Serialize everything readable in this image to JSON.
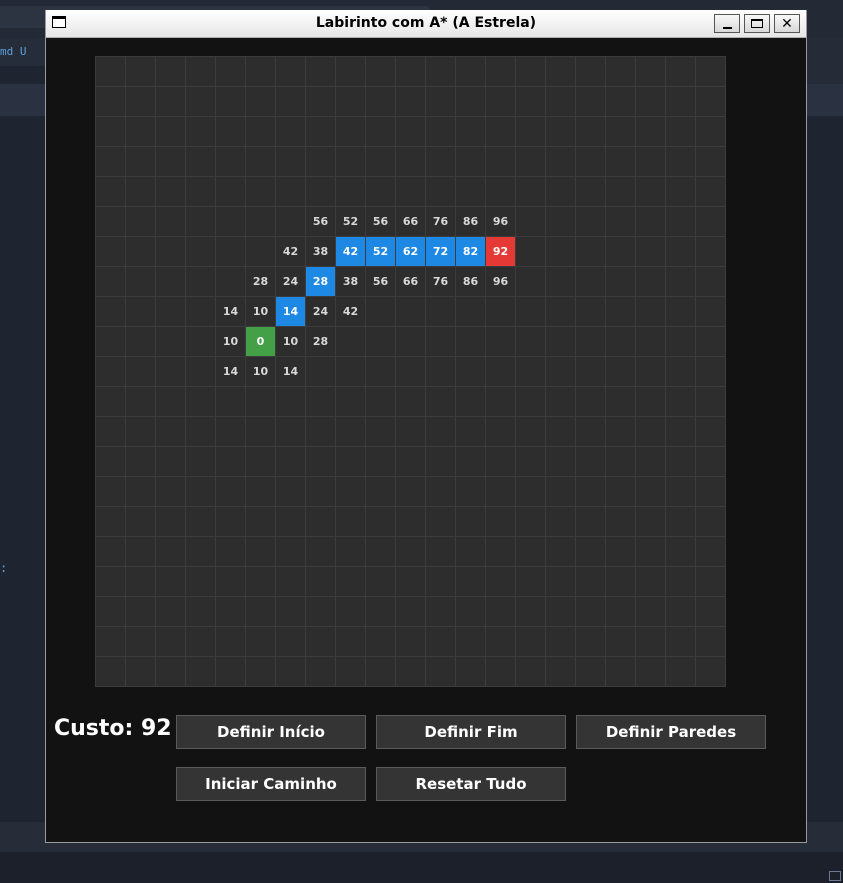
{
  "window": {
    "title": "Labirinto com A* (A Estrela)"
  },
  "background": {
    "tab_text": "md U",
    "side_text": ":"
  },
  "grid": {
    "rows": 21,
    "cols": 21,
    "colors": {
      "empty": "#2d2d2d",
      "path": "#1e88e5",
      "start": "#43a047",
      "end": "#e53935",
      "text": "#d8d8d8"
    },
    "cells": [
      {
        "row": 5,
        "col": 7,
        "value": "56",
        "state": "explored"
      },
      {
        "row": 5,
        "col": 8,
        "value": "52",
        "state": "explored"
      },
      {
        "row": 5,
        "col": 9,
        "value": "56",
        "state": "explored"
      },
      {
        "row": 5,
        "col": 10,
        "value": "66",
        "state": "explored"
      },
      {
        "row": 5,
        "col": 11,
        "value": "76",
        "state": "explored"
      },
      {
        "row": 5,
        "col": 12,
        "value": "86",
        "state": "explored"
      },
      {
        "row": 5,
        "col": 13,
        "value": "96",
        "state": "explored"
      },
      {
        "row": 6,
        "col": 6,
        "value": "42",
        "state": "explored"
      },
      {
        "row": 6,
        "col": 7,
        "value": "38",
        "state": "explored"
      },
      {
        "row": 6,
        "col": 8,
        "value": "42",
        "state": "path"
      },
      {
        "row": 6,
        "col": 9,
        "value": "52",
        "state": "path"
      },
      {
        "row": 6,
        "col": 10,
        "value": "62",
        "state": "path"
      },
      {
        "row": 6,
        "col": 11,
        "value": "72",
        "state": "path"
      },
      {
        "row": 6,
        "col": 12,
        "value": "82",
        "state": "path"
      },
      {
        "row": 6,
        "col": 13,
        "value": "92",
        "state": "end"
      },
      {
        "row": 7,
        "col": 5,
        "value": "28",
        "state": "explored"
      },
      {
        "row": 7,
        "col": 6,
        "value": "24",
        "state": "explored"
      },
      {
        "row": 7,
        "col": 7,
        "value": "28",
        "state": "path"
      },
      {
        "row": 7,
        "col": 8,
        "value": "38",
        "state": "explored"
      },
      {
        "row": 7,
        "col": 9,
        "value": "56",
        "state": "explored"
      },
      {
        "row": 7,
        "col": 10,
        "value": "66",
        "state": "explored"
      },
      {
        "row": 7,
        "col": 11,
        "value": "76",
        "state": "explored"
      },
      {
        "row": 7,
        "col": 12,
        "value": "86",
        "state": "explored"
      },
      {
        "row": 7,
        "col": 13,
        "value": "96",
        "state": "explored"
      },
      {
        "row": 8,
        "col": 4,
        "value": "14",
        "state": "explored"
      },
      {
        "row": 8,
        "col": 5,
        "value": "10",
        "state": "explored"
      },
      {
        "row": 8,
        "col": 6,
        "value": "14",
        "state": "path"
      },
      {
        "row": 8,
        "col": 7,
        "value": "24",
        "state": "explored"
      },
      {
        "row": 8,
        "col": 8,
        "value": "42",
        "state": "explored"
      },
      {
        "row": 9,
        "col": 4,
        "value": "10",
        "state": "explored"
      },
      {
        "row": 9,
        "col": 5,
        "value": "0",
        "state": "start"
      },
      {
        "row": 9,
        "col": 6,
        "value": "10",
        "state": "explored"
      },
      {
        "row": 9,
        "col": 7,
        "value": "28",
        "state": "explored"
      },
      {
        "row": 10,
        "col": 4,
        "value": "14",
        "state": "explored"
      },
      {
        "row": 10,
        "col": 5,
        "value": "10",
        "state": "explored"
      },
      {
        "row": 10,
        "col": 6,
        "value": "14",
        "state": "explored"
      }
    ]
  },
  "controls": {
    "cost_label": "Custo: 92",
    "set_start": "Definir Início",
    "set_end": "Definir Fim",
    "set_walls": "Definir Paredes",
    "start_path": "Iniciar Caminho",
    "reset_all": "Resetar Tudo"
  }
}
